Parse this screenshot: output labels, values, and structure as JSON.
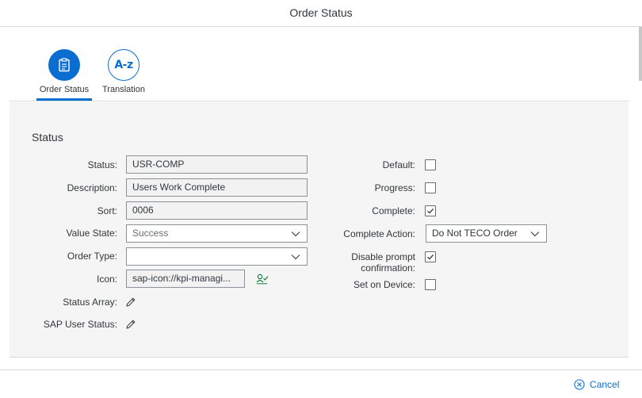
{
  "dialog": {
    "title": "Order Status"
  },
  "tabs": [
    {
      "label": "Order Status",
      "icon": "clipboard-icon",
      "active": true
    },
    {
      "label": "Translation",
      "icon": "a-z-icon",
      "icon_text": "A-z",
      "active": false
    }
  ],
  "section": {
    "title": "Status"
  },
  "left_form": {
    "status": {
      "label": "Status:",
      "value": "USR-COMP"
    },
    "description": {
      "label": "Description:",
      "value": "Users Work Complete"
    },
    "sort": {
      "label": "Sort:",
      "value": "0006"
    },
    "value_state": {
      "label": "Value State:",
      "value": "Success"
    },
    "order_type": {
      "label": "Order Type:",
      "value": ""
    },
    "icon": {
      "label": "Icon:",
      "value": "sap-icon://kpi-managi..."
    },
    "status_array": {
      "label": "Status Array:"
    },
    "sap_user_status": {
      "label": "SAP User Status:"
    }
  },
  "right_form": {
    "default": {
      "label": "Default:",
      "checked": false
    },
    "progress": {
      "label": "Progress:",
      "checked": false
    },
    "complete": {
      "label": "Complete:",
      "checked": true
    },
    "complete_action": {
      "label": "Complete Action:",
      "value": "Do Not TECO Order"
    },
    "disable_prompt": {
      "label_line1": "Disable prompt",
      "label_line2": "confirmation:",
      "checked": true
    },
    "set_on_device": {
      "label": "Set on Device:",
      "checked": false
    }
  },
  "footer": {
    "cancel_label": "Cancel"
  },
  "colors": {
    "accent": "#0a6ed1",
    "success": "#107e3e",
    "panel": "#f5f5f5"
  }
}
